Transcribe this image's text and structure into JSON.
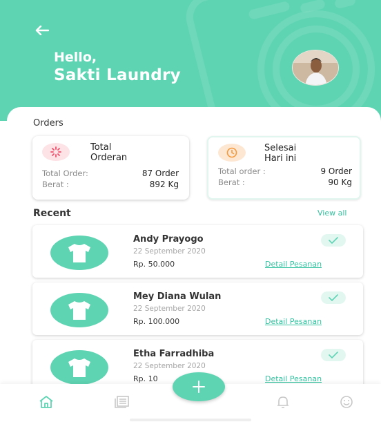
{
  "header": {
    "greeting": "Hello,",
    "shop_name": "Sakti Laundry",
    "back_icon": "arrow-left-icon",
    "avatar": "user-photo-avatar"
  },
  "orders_section": {
    "title": "Orders",
    "cards": [
      {
        "icon": "loading-spinner-icon",
        "title_line1": "Total",
        "title_line2": "Orderan",
        "row1_label": "Total Order:",
        "row1_value": "87 Order",
        "row2_label": "Berat :",
        "row2_value": "892 Kg"
      },
      {
        "icon": "clock-icon",
        "title_line1": "Selesai",
        "title_line2": "Hari ini",
        "row1_label": "Total order :",
        "row1_value": "9 Order",
        "row2_label": "Berat :",
        "row2_value": "90 Kg"
      }
    ]
  },
  "recent_section": {
    "title": "Recent",
    "view_all": "View all",
    "orders": [
      {
        "name": "Andy Prayogo",
        "date": "22 September 2020",
        "price": "Rp. 50.000",
        "detail": "Detail Pesanan"
      },
      {
        "name": "Mey Diana Wulan",
        "date": "22 September 2020",
        "price": "Rp. 100.000",
        "detail": "Detail Pesanan"
      },
      {
        "name": "Etha Farradhiba",
        "date": "22 September 2020",
        "price": "Rp. 10",
        "detail": "Detail Pesanan"
      }
    ]
  },
  "bottom_nav": {
    "items": [
      "home-icon",
      "list-icon",
      "bell-icon",
      "smiley-icon"
    ],
    "fab": "plus-icon"
  },
  "colors": {
    "primary": "#5fd4b3",
    "accent_text": "#33c29f",
    "spinner_bg": "#fde2e6",
    "clock_bg": "#fde7d3"
  }
}
